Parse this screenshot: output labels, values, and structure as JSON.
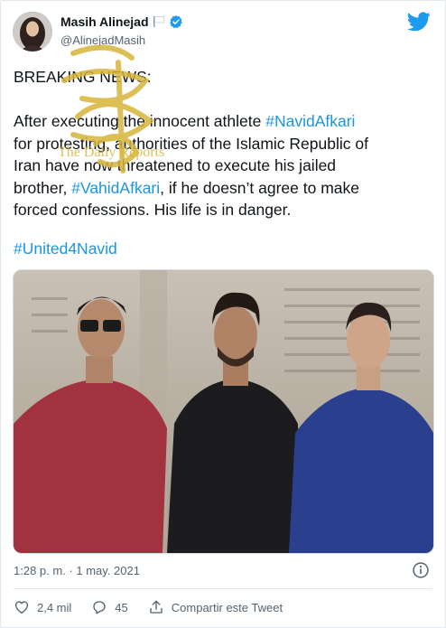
{
  "author": {
    "name": "Masih Alinejad",
    "handle": "@AlinejadMasih",
    "verified": true
  },
  "tweet": {
    "line1": "BREAKING NEWS:",
    "body_parts": {
      "p1": "After executing the innocent athlete ",
      "tag1": "#NavidAfkari",
      "p2": "\nfor protesting, authorities of the Islamic Republic of\nIran have now threatened to execute his jailed\nbrother, ",
      "tag2": "#VahidAfkari",
      "p3": ", if he doesn’t agree to make\nforced confessions. His life is in danger."
    },
    "hashtag": "#United4Navid"
  },
  "watermark": {
    "text": "The Daily Reports"
  },
  "meta": {
    "time": "1:28 p. m.",
    "sep": " · ",
    "date": "1 may. 2021"
  },
  "actions": {
    "likes": "2,4 mil",
    "replies": "45",
    "share": "Compartir este Tweet"
  },
  "colors": {
    "link": "#1b95e0",
    "verified": "#1d9bf0",
    "twitter": "#1d9bf0",
    "muted": "#536471"
  },
  "icons": [
    "flag-icon",
    "verified-badge-icon",
    "twitter-bird-icon",
    "info-icon",
    "heart-icon",
    "reply-icon",
    "share-icon"
  ]
}
